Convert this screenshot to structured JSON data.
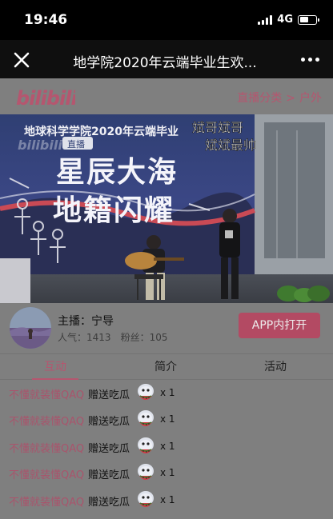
{
  "status_bar": {
    "time": "19:46",
    "network": "4G",
    "signal_bars": 4,
    "battery_level": 0.5
  },
  "nav": {
    "title": "地学院2020年云端毕业生欢...",
    "close_icon": "close-icon",
    "more_icon": "more-icon"
  },
  "header": {
    "logo_text": "bilibili",
    "breadcrumb": [
      "直播分类",
      "户外"
    ],
    "breadcrumb_separator": ">"
  },
  "video": {
    "banner_line1": "地球科学学院2020年云端毕业",
    "banner_line2": "星辰大海",
    "banner_line3": "地籍闪耀",
    "banner_tag": "直播",
    "overlay_line1": "斌哥斌哥",
    "overlay_line2": "斌斌最帅"
  },
  "anchor": {
    "host_label": "主播：宁导",
    "popularity_label": "人气：",
    "popularity": "1413",
    "fans_label": "粉丝：",
    "fans": "105",
    "open_app_label": "APP内打开"
  },
  "tabs": [
    {
      "label": "互动",
      "active": true
    },
    {
      "label": "简介",
      "active": false
    },
    {
      "label": "活动",
      "active": false
    }
  ],
  "gifts": [
    {
      "user": "不懂就装懂QAQ",
      "action": "赠送吃瓜",
      "count": "x 1"
    },
    {
      "user": "不懂就装懂QAQ",
      "action": "赠送吃瓜",
      "count": "x 1"
    },
    {
      "user": "不懂就装懂QAQ",
      "action": "赠送吃瓜",
      "count": "x 1"
    },
    {
      "user": "不懂就装懂QAQ",
      "action": "赠送吃瓜",
      "count": "x 1"
    },
    {
      "user": "不懂就装懂QAQ",
      "action": "赠送吃瓜",
      "count": "x 1"
    }
  ],
  "colors": {
    "accent": "#b5566f",
    "button": "#b34a63",
    "overlay_dim": "#7f7f7f",
    "status_bar": "#000000"
  }
}
